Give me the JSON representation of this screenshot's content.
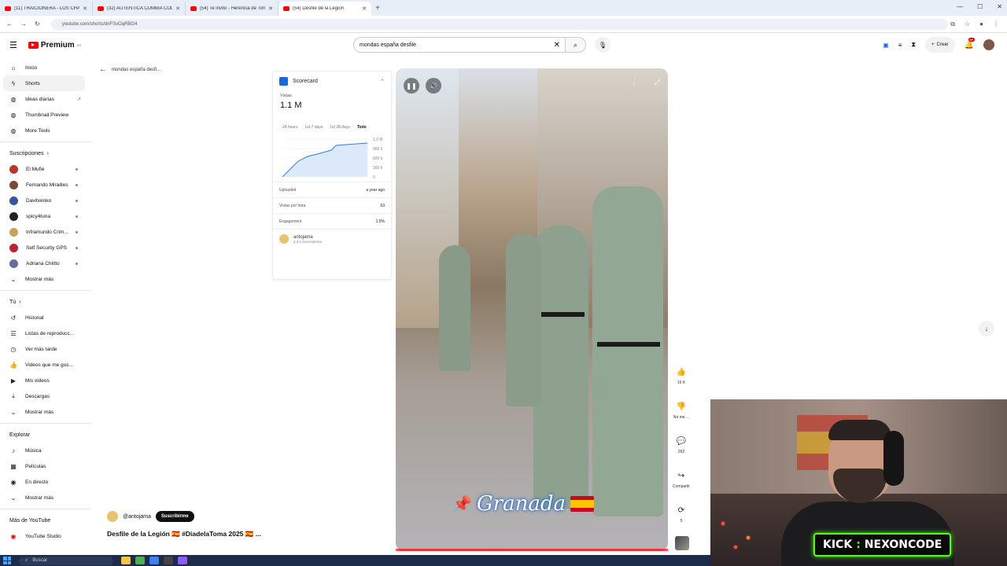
{
  "browser": {
    "tabs": [
      {
        "title": "(11) TRAICIONERA - LOS CHARR"
      },
      {
        "title": "(32) AUTENTICA CUMBIA COL"
      },
      {
        "title": "(54) Te invito - Herencia de Tim"
      },
      {
        "title": "(54) Desfile de la Legión"
      }
    ],
    "url": "youtube.com/shorts/dnFSvOqRBG4"
  },
  "header": {
    "logo_text": "Premium",
    "logo_sup": "ES",
    "search_value": "mondas españa desfile",
    "create_label": "Crear",
    "notif_count": "9+"
  },
  "sidebar": {
    "main": [
      {
        "label": "Inicio",
        "icon": "home-icon"
      },
      {
        "label": "Shorts",
        "icon": "shorts-icon"
      },
      {
        "label": "Ideas diarias",
        "icon": "bulb-icon"
      },
      {
        "label": "Thumbnail Preview",
        "icon": "grid-icon"
      },
      {
        "label": "More Tools",
        "icon": "tools-icon"
      }
    ],
    "subs_title": "Suscripciones",
    "subs": [
      {
        "label": "El Mufie",
        "color": "#b2382b"
      },
      {
        "label": "Fernando Mirailles",
        "color": "#7b4a34"
      },
      {
        "label": "Davitxenko",
        "color": "#3456a3"
      },
      {
        "label": "spicy4tuna",
        "color": "#222222"
      },
      {
        "label": "Inframundo Crim...",
        "color": "#c7a25a"
      },
      {
        "label": "Self Security GPS",
        "color": "#b9252c"
      },
      {
        "label": "Adriana Chiitto",
        "color": "#6b6b9b"
      }
    ],
    "show_more": "Mostrar más",
    "you_title": "Tú",
    "you": [
      {
        "label": "Historial"
      },
      {
        "label": "Listas de reproducc..."
      },
      {
        "label": "Ver más tarde"
      },
      {
        "label": "Videos que me gus..."
      },
      {
        "label": "Mis videos"
      },
      {
        "label": "Descargas"
      },
      {
        "label": "Mostrar más"
      }
    ],
    "explore_title": "Explorar",
    "explore": [
      {
        "label": "Música"
      },
      {
        "label": "Películas"
      },
      {
        "label": "En directo"
      },
      {
        "label": "Mostrar más"
      }
    ],
    "more_title": "Más de YouTube",
    "more": [
      {
        "label": "YouTube Studio"
      }
    ]
  },
  "back_label": "mondas españa desfi...",
  "scorecard": {
    "title": "Scorecard",
    "views_label": "Vistas",
    "views_value": "1.1 M",
    "ranges": [
      "24 hours",
      "1st 7 days",
      "1st 28 days",
      "Todo"
    ],
    "y_ticks": [
      "1.2 M",
      "900 k",
      "600 k",
      "300 k",
      "0"
    ],
    "uploaded_label": "Uploaded",
    "uploaded_value": "a year ago",
    "vph_label": "Vistas por hora",
    "vph_value": "63",
    "engagement_label": "Engagement",
    "engagement_value": "1.5%",
    "channel_name": "antojama",
    "channel_subs": "4.3 k Suscriptores"
  },
  "video": {
    "caption": "Granada",
    "actions": [
      {
        "label": "16 K",
        "icon": "like-icon"
      },
      {
        "label": "No me ...",
        "icon": "dislike-icon"
      },
      {
        "label": "262",
        "icon": "comment-icon"
      },
      {
        "label": "Compartir",
        "icon": "share-icon"
      },
      {
        "label": "5",
        "icon": "remix-icon"
      }
    ]
  },
  "meta": {
    "channel": "@antojama",
    "subscribe": "Suscribirme",
    "title": "Desfile de la Legión 🇪🇸 #DiadelaToma 2025 🇪🇸 ..."
  },
  "webcam": {
    "brand": "KICK",
    "handle": "NEXONCODE"
  },
  "taskbar": {
    "search": "Buscar"
  }
}
